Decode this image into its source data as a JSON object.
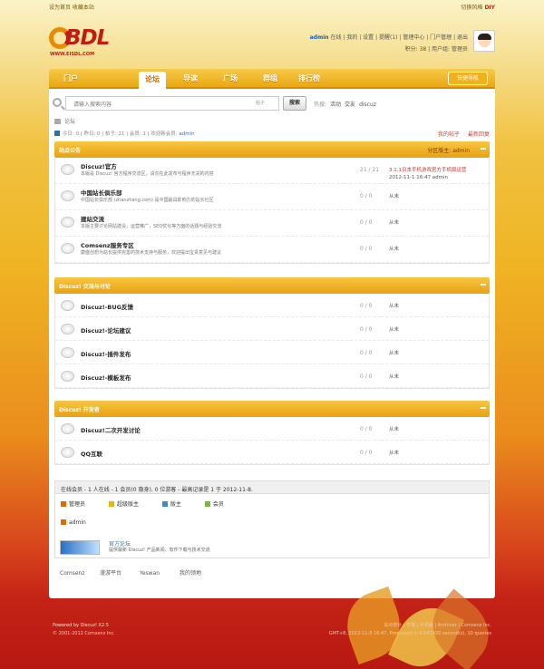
{
  "topbar": {
    "left": "设为首页  收藏本站",
    "right_a": "切换风格",
    "right_b": "DIY"
  },
  "logo": {
    "text": "BDL",
    "url": "WWW.EISDL.COM"
  },
  "user": {
    "name": "admin",
    "line1": "在线 | 我的 | 设置 | 提醒(1) | 管理中心 | 门户管理 | 退出",
    "line2": "积分: 38 | 用户组: 管理员"
  },
  "nav": {
    "items": [
      "门户",
      "论坛",
      "导读",
      "广场",
      "群组",
      "排行榜"
    ],
    "quick": "快捷导航"
  },
  "search": {
    "placeholder": "请输入搜索内容",
    "select": "帖子",
    "button": "搜索",
    "hot_label": "热搜:",
    "hot": [
      "活动",
      "交友",
      "discuz"
    ]
  },
  "breadcrumb": "论坛",
  "stats": {
    "text": "今日: 0 | 昨日: 0 | 帖子: 21 | 会员: 1 | 欢迎新会员:",
    "newest": "admin"
  },
  "tools": [
    "我的帖子",
    "最新回复"
  ],
  "categories": [
    {
      "title": "站点公告",
      "moderator": "分区版主: admin",
      "forums": [
        {
          "name": "Discuz!官方",
          "desc": "本版是 Discuz! 官方程序交流区，请勿在此发布与程序无关的内容",
          "count": "21 / 21",
          "last1": "3.1.1日本手机游戏官方手机版运营",
          "last2": "2012-11-1 16:47 admin"
        },
        {
          "name": "中国站长俱乐部",
          "desc": "中国站长俱乐部 (zhanzhang.com) 是中国最具影响力的站长社区",
          "count": "0 / 0",
          "last1": "从未",
          "last2": ""
        },
        {
          "name": "建站交流",
          "desc": "本版主要讨论网站建设，运营推广，SEO优化等方面的话题与经验交流",
          "count": "0 / 0",
          "last1": "从未",
          "last2": ""
        },
        {
          "name": "Comsenz服务专区",
          "desc": "康盛创想为站长提供完善的技术支持与服务，欢迎提出宝贵意见与建议",
          "count": "0 / 0",
          "last1": "从未",
          "last2": ""
        }
      ]
    },
    {
      "title": "Discuz! 交流与讨论",
      "moderator": "",
      "forums": [
        {
          "name": "Discuz!-BUG反馈",
          "desc": "",
          "count": "0 / 0",
          "last1": "从未",
          "last2": ""
        },
        {
          "name": "Discuz!-论坛建议",
          "desc": "",
          "count": "0 / 0",
          "last1": "从未",
          "last2": ""
        },
        {
          "name": "Discuz!-插件发布",
          "desc": "",
          "count": "0 / 0",
          "last1": "从未",
          "last2": ""
        },
        {
          "name": "Discuz!-模板发布",
          "desc": "",
          "count": "0 / 0",
          "last1": "从未",
          "last2": ""
        }
      ]
    },
    {
      "title": "Discuz! 开发者",
      "moderator": "",
      "forums": [
        {
          "name": "Discuz!二次开发讨论",
          "desc": "",
          "count": "0 / 0",
          "last1": "从未",
          "last2": ""
        },
        {
          "name": "QQ互联",
          "desc": "",
          "count": "0 / 0",
          "last1": "从未",
          "last2": ""
        }
      ]
    }
  ],
  "online": {
    "header": "在线会员 - 1 人在线 - 1 会员(0 隐身), 0 位游客 - 最高记录是 1 于 2012-11-8.",
    "legend": [
      "管理员",
      "超级版主",
      "版主",
      "会员"
    ],
    "users": [
      "admin"
    ]
  },
  "links": {
    "title": "官方论坛",
    "desc": "提供最新 Discuz! 产品新闻、软件下载与技术交流",
    "friends": [
      "Comsenz",
      "漫游平台",
      "Yeswan",
      "我的领地"
    ]
  },
  "footer": {
    "powered": "Powered by Discuz! X2.5",
    "copy": "© 2001-2012 Comsenz Inc.",
    "links": "站点统计 | 举报 | 手机版 | Archiver | Comsenz Inc.",
    "time": "GMT+8, 2012-11-8 16:47, Processed in 0.041920 second(s), 10 queries"
  },
  "colors": {
    "accent": "#e8a114",
    "red": "#c31a12",
    "link": "#2c6fb6"
  }
}
